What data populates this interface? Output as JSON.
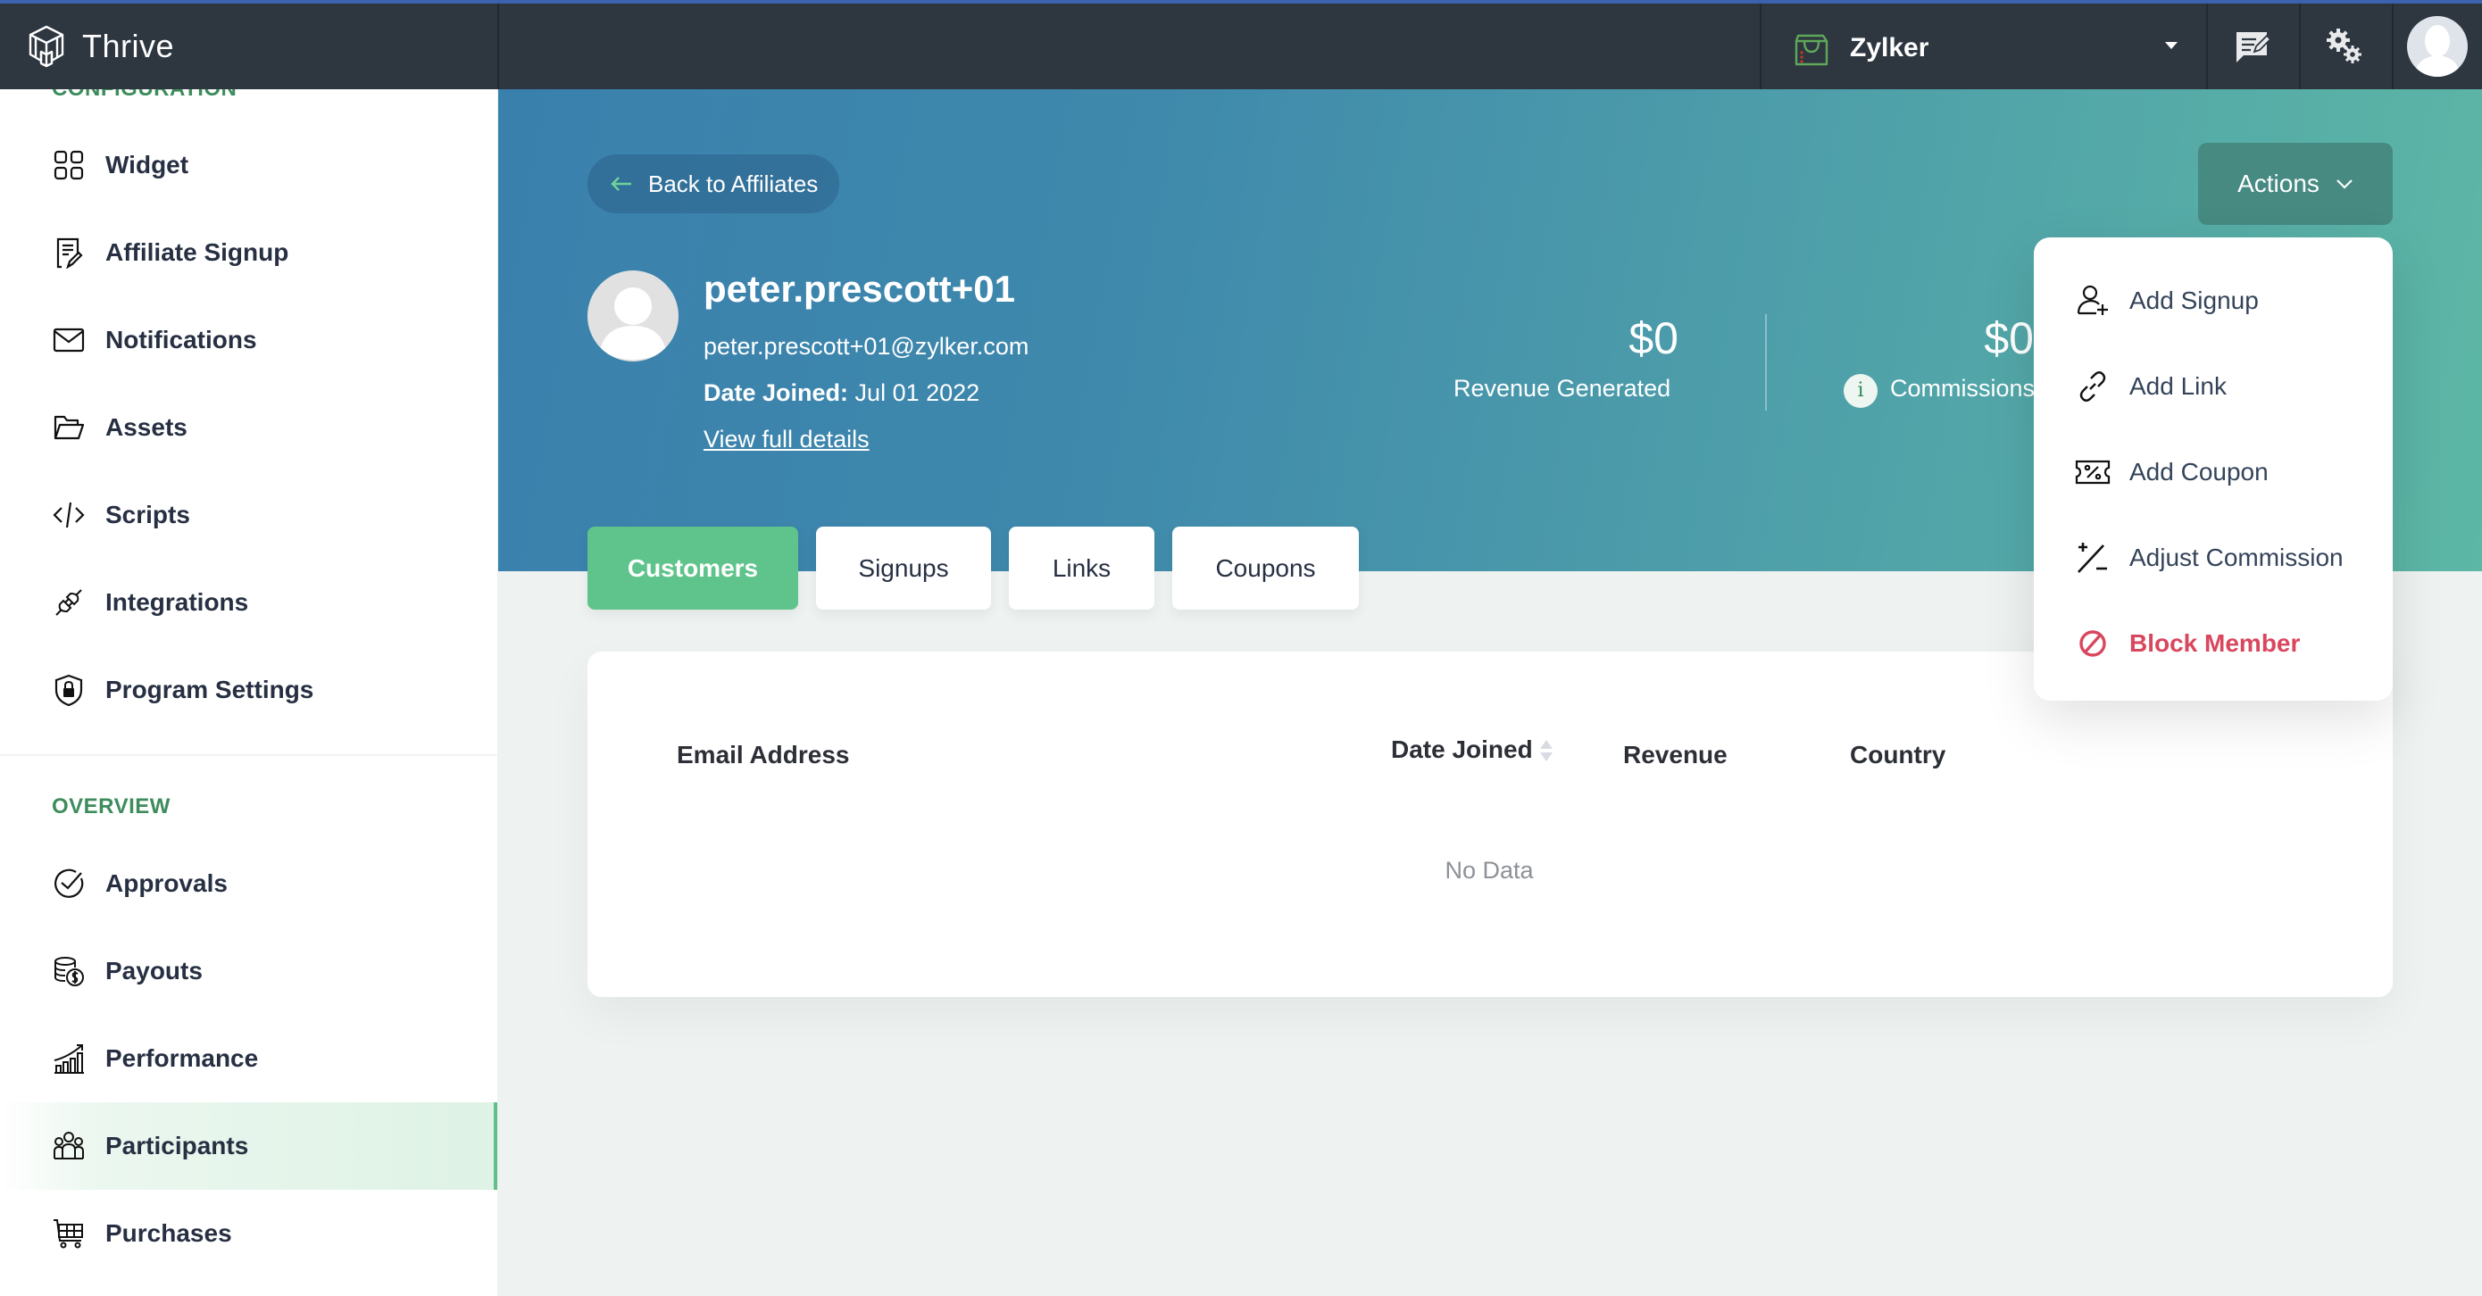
{
  "app": {
    "name": "Thrive",
    "top_accent_color": "#3b63ad"
  },
  "header": {
    "store_name": "Zylker",
    "icons": [
      "store-bag-icon",
      "caret-down-icon",
      "feedback-icon",
      "settings-gears-icon",
      "user-avatar"
    ]
  },
  "sidebar": {
    "sections": [
      {
        "label": "CONFIGURATION",
        "items": [
          {
            "label": "Widget",
            "icon": "grid-icon"
          },
          {
            "label": "Affiliate Signup",
            "icon": "form-edit-icon"
          },
          {
            "label": "Notifications",
            "icon": "envelope-icon"
          },
          {
            "label": "Assets",
            "icon": "folder-open-icon"
          },
          {
            "label": "Scripts",
            "icon": "code-icon"
          },
          {
            "label": "Integrations",
            "icon": "plug-icon"
          },
          {
            "label": "Program Settings",
            "icon": "shield-lock-icon"
          }
        ]
      },
      {
        "label": "OVERVIEW",
        "items": [
          {
            "label": "Approvals",
            "icon": "check-circle-icon"
          },
          {
            "label": "Payouts",
            "icon": "coins-dollar-icon"
          },
          {
            "label": "Performance",
            "icon": "growth-chart-icon"
          },
          {
            "label": "Participants",
            "icon": "people-icon",
            "active": true
          },
          {
            "label": "Purchases",
            "icon": "cart-icon"
          }
        ]
      }
    ],
    "accent_color": "#3d8c5c",
    "active_indicator_color": "#5ec08b"
  },
  "banner": {
    "back_label": "Back to Affiliates",
    "actions_label": "Actions",
    "profile": {
      "name": "peter.prescott+01",
      "email": "peter.prescott+01@zylker.com",
      "date_joined_label": "Date Joined:",
      "date_joined_value": "Jul 01 2022",
      "view_details_label": "View full details"
    },
    "stats": [
      {
        "value": "$0",
        "label": "Revenue Generated"
      },
      {
        "value": "$0",
        "label": "Commissions",
        "info_icon": true
      }
    ],
    "gradient": [
      "#3a80ad",
      "#5db7a5"
    ]
  },
  "actions_menu": {
    "items": [
      {
        "label": "Add Signup",
        "icon": "user-plus-icon"
      },
      {
        "label": "Add Link",
        "icon": "link-icon"
      },
      {
        "label": "Add Coupon",
        "icon": "coupon-icon"
      },
      {
        "label": "Adjust Commission",
        "icon": "plus-minus-icon"
      },
      {
        "label": "Block Member",
        "icon": "block-icon",
        "danger": true
      }
    ],
    "danger_color": "#d9475e"
  },
  "tabs": [
    {
      "label": "Customers",
      "active": true
    },
    {
      "label": "Signups"
    },
    {
      "label": "Links"
    },
    {
      "label": "Coupons"
    }
  ],
  "table": {
    "columns": [
      "Email Address",
      "Date Joined",
      "Revenue",
      "Country"
    ],
    "sortable_column": "Date Joined",
    "rows": [],
    "empty_text": "No Data"
  },
  "colors": {
    "tab_active": "#5fc48b",
    "header_bg": "#2e3640"
  }
}
